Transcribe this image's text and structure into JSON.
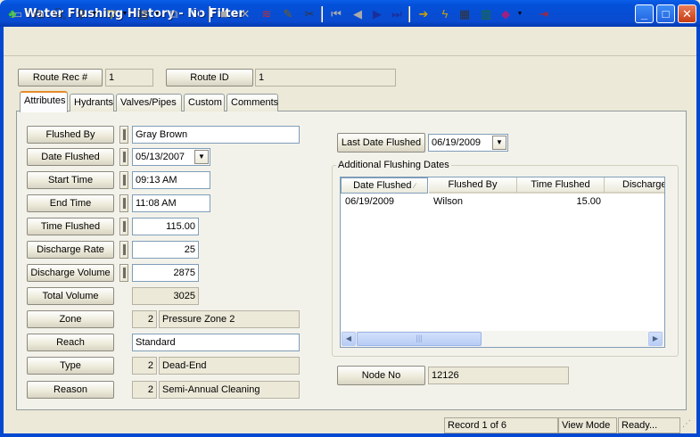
{
  "window": {
    "title": "Water Flushing History - No Filter"
  },
  "toolbar_icons": [
    "new-icon",
    "print-icon",
    "preview-icon",
    "find-icon",
    "filter-icon",
    "document-icon",
    "copy-icon",
    "paste-icon",
    "save-icon",
    "delete-icon",
    "stack-icon",
    "edit-icon",
    "cut-icon",
    "first-icon",
    "prev-icon",
    "next-icon",
    "last-icon",
    "arrow-right-icon",
    "lightning-icon",
    "map-icon",
    "calculator-icon",
    "book-icon",
    "exit-icon"
  ],
  "header": {
    "route_rec_label": "Route Rec #",
    "route_rec_value": "1",
    "route_id_label": "Route ID",
    "route_id_value": "1"
  },
  "tabs": [
    "Attributes",
    "Hydrants",
    "Valves/Pipes",
    "Custom",
    "Comments"
  ],
  "fields": {
    "flushed_by": {
      "label": "Flushed By",
      "value": "Gray Brown"
    },
    "date_flushed": {
      "label": "Date Flushed",
      "value": "05/13/2007"
    },
    "start_time": {
      "label": "Start Time",
      "value": "09:13 AM"
    },
    "end_time": {
      "label": "End Time",
      "value": "11:08 AM"
    },
    "time_flushed": {
      "label": "Time Flushed",
      "value": "115.00"
    },
    "discharge_rate": {
      "label": "Discharge Rate",
      "value": "25"
    },
    "discharge_volume": {
      "label": "Discharge Volume",
      "value": "2875"
    },
    "total_volume": {
      "label": "Total Volume",
      "value": "3025"
    },
    "zone": {
      "label": "Zone",
      "code": "2",
      "value": "Pressure Zone 2"
    },
    "reach": {
      "label": "Reach",
      "value": "Standard"
    },
    "type": {
      "label": "Type",
      "code": "2",
      "value": "Dead-End"
    },
    "reason": {
      "label": "Reason",
      "code": "2",
      "value": "Semi-Annual Cleaning"
    }
  },
  "last_date": {
    "label": "Last Date Flushed",
    "value": "06/19/2009"
  },
  "additional": {
    "title": "Additional Flushing Dates",
    "columns": [
      "Date Flushed",
      "Flushed By",
      "Time Flushed",
      "Discharge"
    ],
    "rows": [
      {
        "date": "06/19/2009",
        "by": "Wilson",
        "time": "15.00",
        "discharge": ""
      }
    ]
  },
  "node": {
    "label": "Node No",
    "value": "12126"
  },
  "status": {
    "record": "Record 1 of 6",
    "mode": "View Mode",
    "state": "Ready..."
  }
}
